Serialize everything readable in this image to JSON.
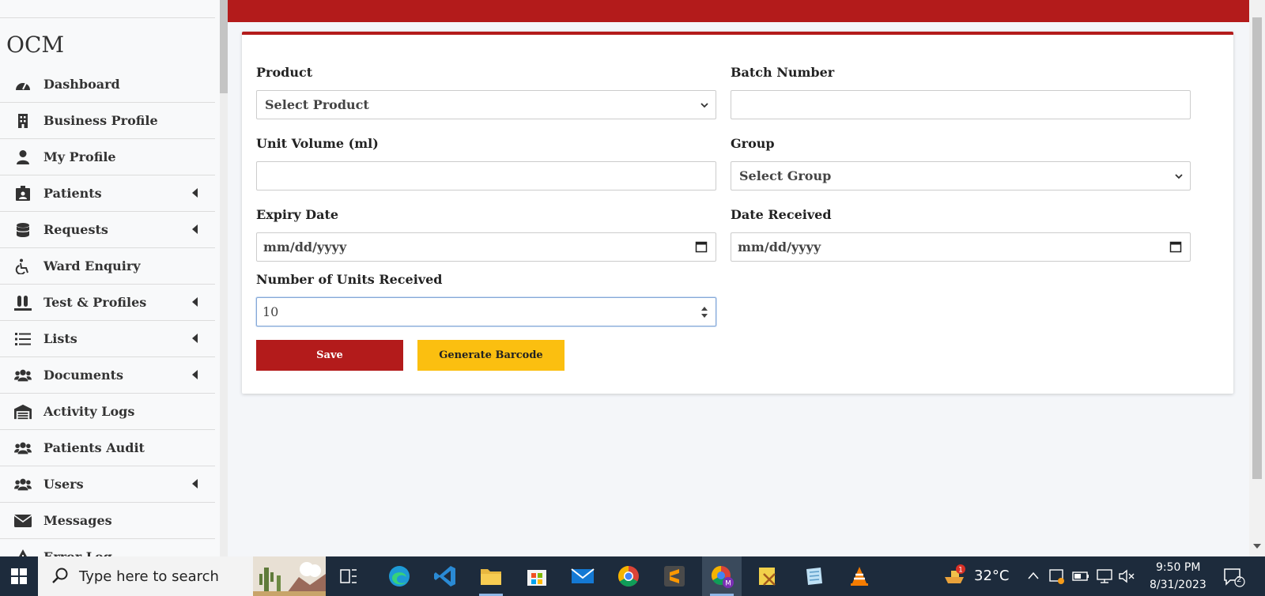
{
  "sidebar": {
    "brand": "OCM",
    "items": [
      {
        "label": "Dashboard",
        "icon": "dashboard-icon",
        "caret": false
      },
      {
        "label": "Business Profile",
        "icon": "building-icon",
        "caret": false
      },
      {
        "label": "My Profile",
        "icon": "user-icon",
        "caret": false
      },
      {
        "label": "Patients",
        "icon": "id-card-icon",
        "caret": true
      },
      {
        "label": "Requests",
        "icon": "database-icon",
        "caret": true
      },
      {
        "label": "Ward Enquiry",
        "icon": "wheelchair-icon",
        "caret": false
      },
      {
        "label": "Test & Profiles",
        "icon": "test-tubes-icon",
        "caret": true
      },
      {
        "label": "Lists",
        "icon": "list-icon",
        "caret": true
      },
      {
        "label": "Documents",
        "icon": "users-icon",
        "caret": true
      },
      {
        "label": "Activity Logs",
        "icon": "warehouse-icon",
        "caret": false
      },
      {
        "label": "Patients Audit",
        "icon": "users-icon",
        "caret": false
      },
      {
        "label": "Users",
        "icon": "users-icon",
        "caret": true
      },
      {
        "label": "Messages",
        "icon": "envelope-icon",
        "caret": false
      },
      {
        "label": "Error Log",
        "icon": "warning-icon",
        "caret": false
      }
    ]
  },
  "form": {
    "product_label": "Product",
    "product_value": "Select Product",
    "batch_label": "Batch Number",
    "batch_value": "",
    "unit_volume_label": "Unit Volume (ml)",
    "unit_volume_value": "",
    "group_label": "Group",
    "group_value": "Select Group",
    "expiry_label": "Expiry Date",
    "expiry_placeholder": "mm/dd/yyyy",
    "received_label": "Date Received",
    "received_placeholder": "mm/dd/yyyy",
    "units_label": "Number of Units Received",
    "units_value": "10",
    "save_label": "Save",
    "barcode_label": "Generate Barcode"
  },
  "colors": {
    "accent_red": "#b31b1b",
    "accent_yellow": "#fbbf10"
  },
  "taskbar": {
    "search_placeholder": "Type here to search",
    "weather_temp": "32°C",
    "weather_badge": "1",
    "time": "9:50 PM",
    "date": "8/31/2023",
    "notification_count": "2"
  }
}
